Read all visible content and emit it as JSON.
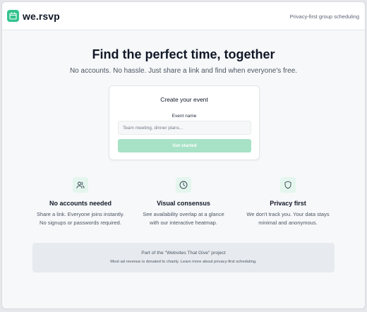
{
  "header": {
    "brand": "we.rsvp",
    "tagline": "Privacy-first group scheduling"
  },
  "hero": {
    "title": "Find the perfect time, together",
    "subtitle": "No accounts. No hassle. Just share a link and find when everyone's free."
  },
  "create_card": {
    "title": "Create your event",
    "field_label": "Event name",
    "field_value": "",
    "field_placeholder": "Team meeting, dinner plans...",
    "button_label": "Get started"
  },
  "features": [
    {
      "icon": "users-icon",
      "title": "No accounts needed",
      "line1": "Share a link. Everyone joins instantly.",
      "line2": "No signups or passwords required."
    },
    {
      "icon": "clock-icon",
      "title": "Visual consensus",
      "line1": "See availability overlap at a glance",
      "line2": "with our interactive heatmap."
    },
    {
      "icon": "shield-icon",
      "title": "Privacy first",
      "line1": "We don't track you. Your data stays",
      "line2": "minimal and anonymous."
    }
  ],
  "footer": {
    "line1": "Part of the \"Websites That Give\" project",
    "line2_text": "Most ad revenue is donated to charity. ",
    "line2_link": "Learn more about privacy-first scheduling."
  },
  "colors": {
    "accent": "#34c38f",
    "button_disabled": "#a7e2c6",
    "icon_bg": "#e4f6ee"
  }
}
